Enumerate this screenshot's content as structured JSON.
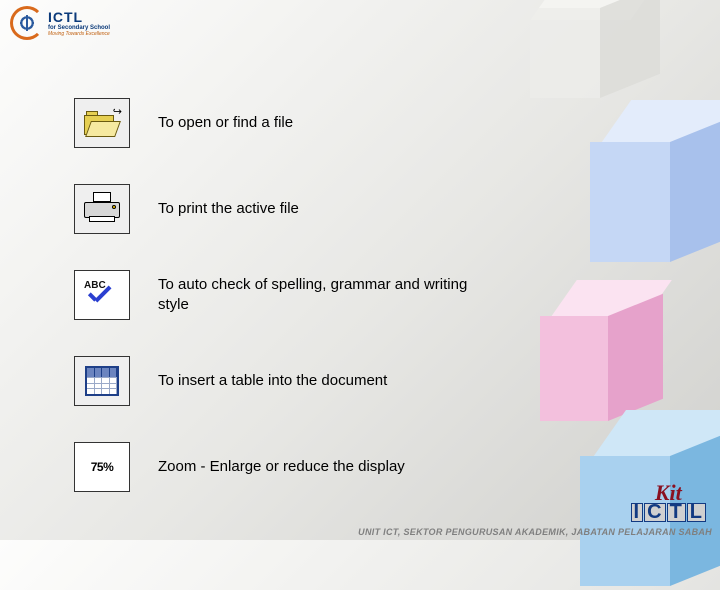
{
  "logo": {
    "title": "ICTL",
    "subtitle": "for Secondary School",
    "tagline": "Moving Towards Excellence"
  },
  "items": [
    {
      "label": "To open or find a file"
    },
    {
      "label": "To print the active file"
    },
    {
      "label": "To auto check of spelling, grammar and writing style"
    },
    {
      "label": "To insert a table into the document"
    },
    {
      "label": "Zoom - Enlarge or reduce the display"
    }
  ],
  "spell_abc": "ABC",
  "zoom_value": "75%",
  "footer": "UNIT ICT, SEKTOR PENGURUSAN AKADEMIK, JABATAN PELAJARAN SABAH",
  "kit": {
    "top": "Kit",
    "bottom": "ICTL"
  }
}
